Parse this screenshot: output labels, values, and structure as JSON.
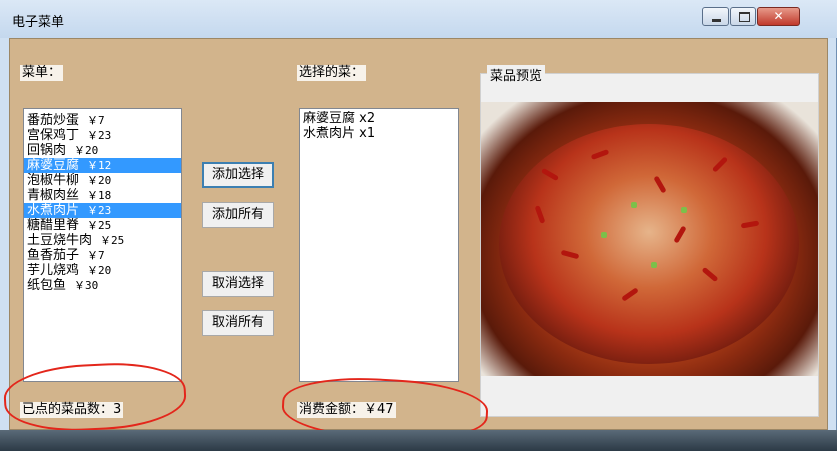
{
  "window": {
    "title": "电子菜单",
    "buttons": {
      "minimize": "–",
      "maximize": "□",
      "close": "✕"
    }
  },
  "menu": {
    "label": "菜单：",
    "items": [
      {
        "name": "番茄炒蛋",
        "price": "￥7",
        "selected": false
      },
      {
        "name": "宫保鸡丁",
        "price": "￥23",
        "selected": false
      },
      {
        "name": "回锅肉",
        "price": "￥20",
        "selected": false
      },
      {
        "name": "麻婆豆腐",
        "price": "￥12",
        "selected": true
      },
      {
        "name": "泡椒牛柳",
        "price": "￥20",
        "selected": false
      },
      {
        "name": "青椒肉丝",
        "price": "￥18",
        "selected": false
      },
      {
        "name": "水煮肉片",
        "price": "￥23",
        "selected": true
      },
      {
        "name": "糖醋里脊",
        "price": "￥25",
        "selected": false
      },
      {
        "name": "土豆烧牛肉",
        "price": "￥25",
        "selected": false
      },
      {
        "name": "鱼香茄子",
        "price": "￥7",
        "selected": false
      },
      {
        "name": "芋儿烧鸡",
        "price": "￥20",
        "selected": false
      },
      {
        "name": "纸包鱼",
        "price": "￥30",
        "selected": false
      }
    ]
  },
  "buttons": {
    "add_selected": "添加选择",
    "add_all": "添加所有",
    "remove_selected": "取消选择",
    "remove_all": "取消所有"
  },
  "chosen": {
    "label": "选择的菜：",
    "items": [
      "麻婆豆腐 x2",
      "水煮肉片 x1"
    ]
  },
  "preview": {
    "label": "菜品预览"
  },
  "footer": {
    "count_text": "已点的菜品数：3",
    "total_text": "消费金额：￥47"
  },
  "colors": {
    "client_bg": "#d2b48c",
    "selection": "#3399ff",
    "annotation": "#e3261b"
  }
}
